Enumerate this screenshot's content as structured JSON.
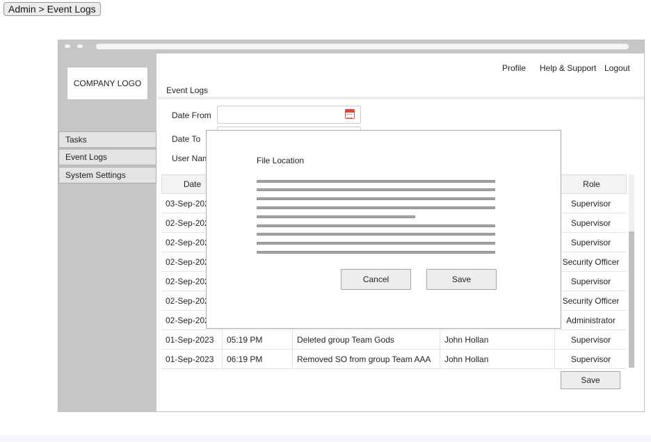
{
  "breadcrumb": "Admin > Event Logs",
  "company_logo": "COMPANY LOGO",
  "sidebar": {
    "items": [
      {
        "label": "Tasks"
      },
      {
        "label": "Event Logs"
      },
      {
        "label": "System Settings"
      }
    ]
  },
  "header": {
    "links": [
      "Profile",
      "Help & Support",
      "Logout"
    ],
    "title": "Event Logs"
  },
  "filters": {
    "date_from_label": "Date From",
    "date_to_label": "Date To",
    "user_name_label": "User Nam",
    "date_from_value": "",
    "date_to_value": "",
    "user_name_value": ""
  },
  "table": {
    "headers": [
      "Date",
      "",
      "",
      "",
      "Role"
    ],
    "rows": [
      [
        "03-Sep-202",
        "",
        "",
        "",
        "Supervisor"
      ],
      [
        "02-Sep-202",
        "",
        "",
        "",
        "Supervisor"
      ],
      [
        "02-Sep-202",
        "",
        "",
        "",
        "Supervisor"
      ],
      [
        "02-Sep-202",
        "",
        "",
        "",
        "Security Officer"
      ],
      [
        "02-Sep-202",
        "",
        "",
        "",
        "Supervisor"
      ],
      [
        "02-Sep-202",
        "",
        "",
        "",
        "Security Officer"
      ],
      [
        "02-Sep-202",
        "",
        "",
        "",
        "Administrator"
      ],
      [
        "01-Sep-2023",
        "05:19 PM",
        "Deleted group Team Gods",
        "John Hollan",
        "Supervisor"
      ],
      [
        "01-Sep-2023",
        "06:19 PM",
        "Removed SO from group Team AAA",
        "John Hollan",
        "Supervisor"
      ]
    ]
  },
  "page_save_label": "Save",
  "modal": {
    "title": "File Location",
    "cancel_label": "Cancel",
    "save_label": "Save"
  },
  "colors": {
    "sidebar": "#c6c6c6",
    "nav_item": "#e3e3e3",
    "calendar_icon": "#d9483b"
  },
  "icons": [
    "calendar-icon"
  ]
}
